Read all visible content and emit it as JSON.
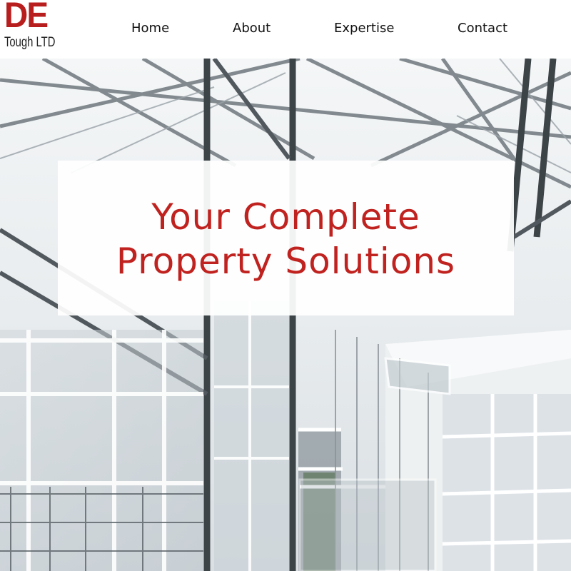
{
  "logo": {
    "main": "DE",
    "sub": "Tough LTD"
  },
  "nav": {
    "home": "Home",
    "about": "About",
    "expertise": "Expertise",
    "contact": "Contact"
  },
  "hero": {
    "headline_line1": "Your Complete",
    "headline_line2": "Property Solutions",
    "image": "glass-atrium-building-photo"
  },
  "colors": {
    "brand_red": "#c0221f",
    "nav_text": "#111111",
    "background": "#ffffff"
  }
}
